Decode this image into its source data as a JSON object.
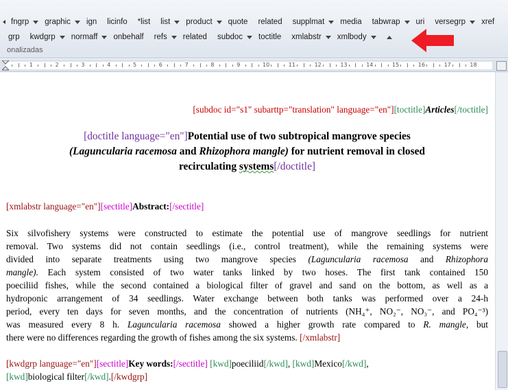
{
  "ribbon": {
    "row1": [
      "fngrp",
      "graphic",
      "ign",
      "licinfo",
      "*list",
      "list",
      "product",
      "quote",
      "related",
      "supplmat",
      "media",
      "tabwrap",
      "uri",
      "versegrp",
      "xref"
    ],
    "row1_dd": [
      true,
      true,
      false,
      false,
      false,
      true,
      true,
      false,
      false,
      true,
      false,
      true,
      false,
      true,
      false
    ],
    "row2": [
      "grp",
      "kwdgrp",
      "normaff",
      "onbehalf",
      "refs",
      "related",
      "subdoc",
      "toctitle",
      "xmlabstr",
      "xmlbody"
    ],
    "row2_dd": [
      false,
      true,
      true,
      false,
      true,
      false,
      true,
      false,
      true,
      true
    ],
    "group_label": "onalizadas"
  },
  "ruler": {
    "numbers": [
      "1",
      "2",
      "3",
      "4",
      "5",
      "6",
      "7",
      "8",
      "9",
      "10",
      "11",
      "12",
      "13",
      "14",
      "15",
      "16",
      "17",
      "18"
    ]
  },
  "doc": {
    "subdoc_line": "[subdoc id=\"s1\" subarttp=\"translation\" language=\"en\"]",
    "toctitle_open": "[toctitle]",
    "toctitle_text": "Articles",
    "toctitle_close": "[/toctitle]",
    "doctitle_open": "[doctitle language=\"en\"]",
    "title_l1": "Potential use of two subtropical mangrove species",
    "title_l2_i1": "(Laguncularia racemosa",
    "title_l2_and": " and ",
    "title_l2_i2": "Rhizophora mangle)",
    "title_l2_rest": " for nutrient removal in closed",
    "title_l3": "recirculating",
    "title_l3_sq": "systems",
    "doctitle_close": "[/doctitle]",
    "xmlabstr_open": "[xmlabstr language=\"en\"]",
    "sectitle_open": "[sectitle]",
    "abstract_label": "Abstract:",
    "sectitle_close": "[/sectitle]",
    "abs_l1": "Six silvofishery systems were constructed to estimate the potential use of mangrove seedlings for nutrient",
    "abs_l2": "removal. Two systems did not contain seedlings (i.e., control treatment), while the remaining systems were",
    "abs_l3a": "divided into separate treatments using two mangrove species ",
    "abs_l3b": "(Laguncularia racemosa",
    "abs_l3c": " and ",
    "abs_l3d": "Rhizophora",
    "abs_l4a": "mangle).",
    "abs_l4b": " Each system consisted of two water tanks linked by two hoses. The first tank contained 150",
    "abs_l5": "poeciliid fishes, while the second contained a biological filter of gravel and sand on the bottom, as well as a",
    "abs_l6": "hydroponic arrangement of 34 seedlings. Water exchange between both tanks was performed over a 24-h",
    "abs_l7": "period, every ten days for seven months, and the concentration of nutrients (NH₄⁺, NO₂⁻, NO₃⁻, and PO₄⁻³)",
    "abs_l8a": "was measured every 8 h. ",
    "abs_l8b": "Laguncularia racemosa",
    "abs_l8c": " showed a higher growth rate compared to ",
    "abs_l8d": "R. mangle,",
    "abs_l8e": " but",
    "abs_l9": "there were no differences regarding the growth of fishes among the six systems. ",
    "xmlabstr_close": "[/xmlabstr]",
    "kwdgrp_open": "[kwdgrp language=\"en\"]",
    "kw_label": "Key words:",
    "kwd_open": "[kwd]",
    "kwd_close": "[/kwd]",
    "kw1": "poeciliid",
    "kw2": "Mexico",
    "kw3": "biological filter",
    "kwdgrp_close": "[/kwdgrp]",
    "comma": ", ",
    "dot": "."
  }
}
